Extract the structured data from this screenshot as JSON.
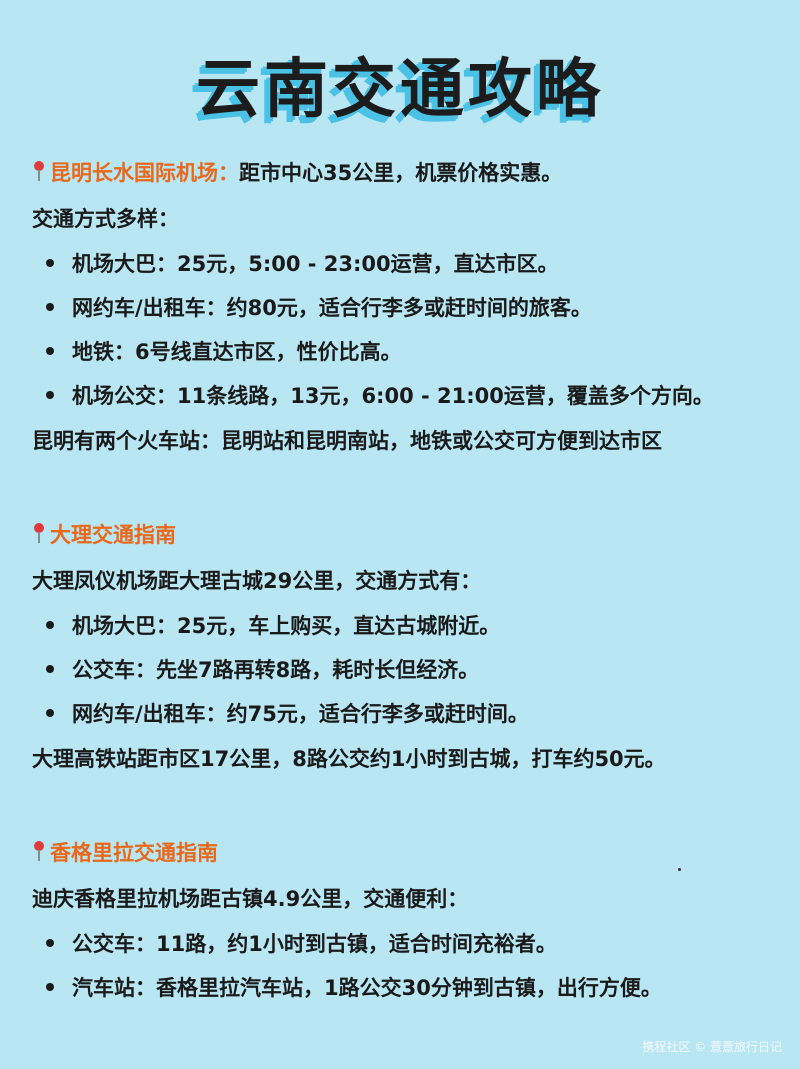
{
  "title": "云南交通攻略",
  "sections": [
    {
      "heading": "昆明长水国际机场：",
      "heading_tail": "距市中心35公里，机票价格实惠。",
      "intro": "交通方式多样：",
      "items": [
        "机场大巴：25元，5:00 - 23:00运营，直达市区。",
        "网约车/出租车：约80元，适合行李多或赶时间的旅客。",
        "地铁：6号线直达市区，性价比高。",
        "机场公交：11条线路，13元，6:00 - 21:00运营，覆盖多个方向。"
      ],
      "footer": "昆明有两个火车站：昆明站和昆明南站，地铁或公交可方便到达市区"
    },
    {
      "heading": "大理交通指南",
      "intro": "大理凤仪机场距大理古城29公里，交通方式有：",
      "items": [
        "机场大巴：25元，车上购买，直达古城附近。",
        "公交车：先坐7路再转8路，耗时长但经济。",
        "网约车/出租车：约75元，适合行李多或赶时间。"
      ],
      "footer": "大理高铁站距市区17公里，8路公交约1小时到古城，打车约50元。"
    },
    {
      "heading": "香格里拉交通指南",
      "intro": "迪庆香格里拉机场距古镇4.9公里，交通便利：",
      "items": [
        "公交车：11路，约1小时到古镇，适合时间充裕者。",
        "汽车站：香格里拉汽车站，1路公交30分钟到古镇，出行方便。"
      ]
    }
  ],
  "watermark": "携程社区 © 薏薏旅行日记",
  "colors": {
    "background": "#b9e6f3",
    "heading": "#e8681c",
    "title_shadow": "#4cc1e6"
  },
  "icons": {
    "heading_marker": "round-pushpin-icon"
  }
}
